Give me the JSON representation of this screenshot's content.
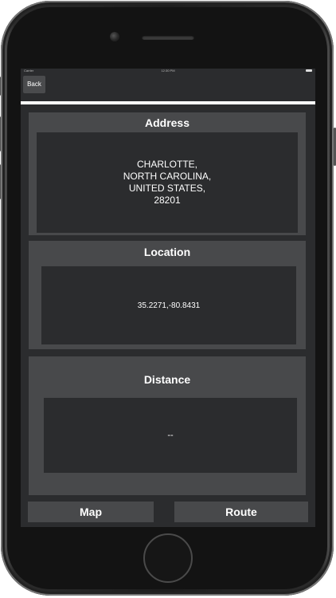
{
  "status_bar": {
    "carrier": "Carrier",
    "time": "12:30 PM"
  },
  "nav": {
    "back_label": "Back"
  },
  "address": {
    "title": "Address",
    "value": "CHARLOTTE,\nNORTH CAROLINA,\nUNITED STATES,\n28201"
  },
  "location": {
    "title": "Location",
    "value": "35.2271,-80.8431"
  },
  "distance": {
    "title": "Distance",
    "value": "--"
  },
  "actions": {
    "map_label": "Map",
    "route_label": "Route"
  },
  "colors": {
    "screen_background": "#2b2c2e",
    "panel_background": "#48494b",
    "text": "#ffffff"
  }
}
